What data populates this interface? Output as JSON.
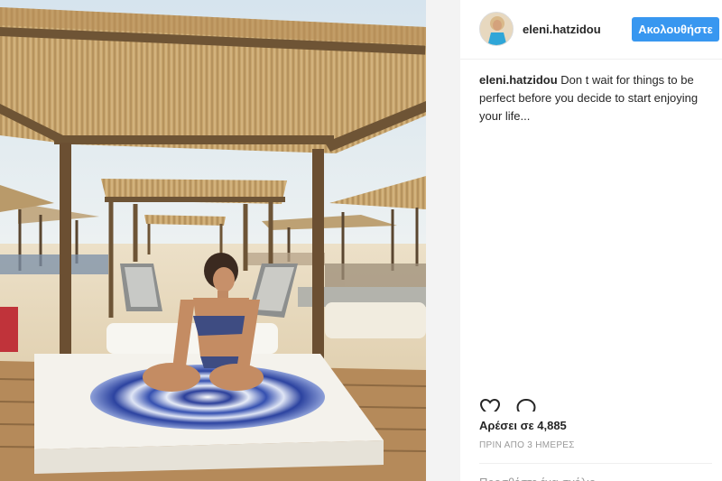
{
  "post": {
    "username": "eleni.hatzidou",
    "follow_label": "Ακολουθήστε",
    "caption_username": "eleni.hatzidou",
    "caption_text": "Don t wait for things to be perfect before you decide to start enjoying your life...",
    "likes_text": "Αρέσει σε 4,885",
    "time_text": "ΠΡΙΝ ΑΠΟ 3 ΗΜΕΡΕΣ",
    "comment_placeholder": "Προσθέστε ένα σχόλιο..."
  },
  "icons": {
    "like": "heart-icon",
    "comment": "comment-icon",
    "avatar": "avatar"
  },
  "colors": {
    "follow_button": "#3897f0",
    "text": "#262626",
    "muted": "#999999"
  }
}
